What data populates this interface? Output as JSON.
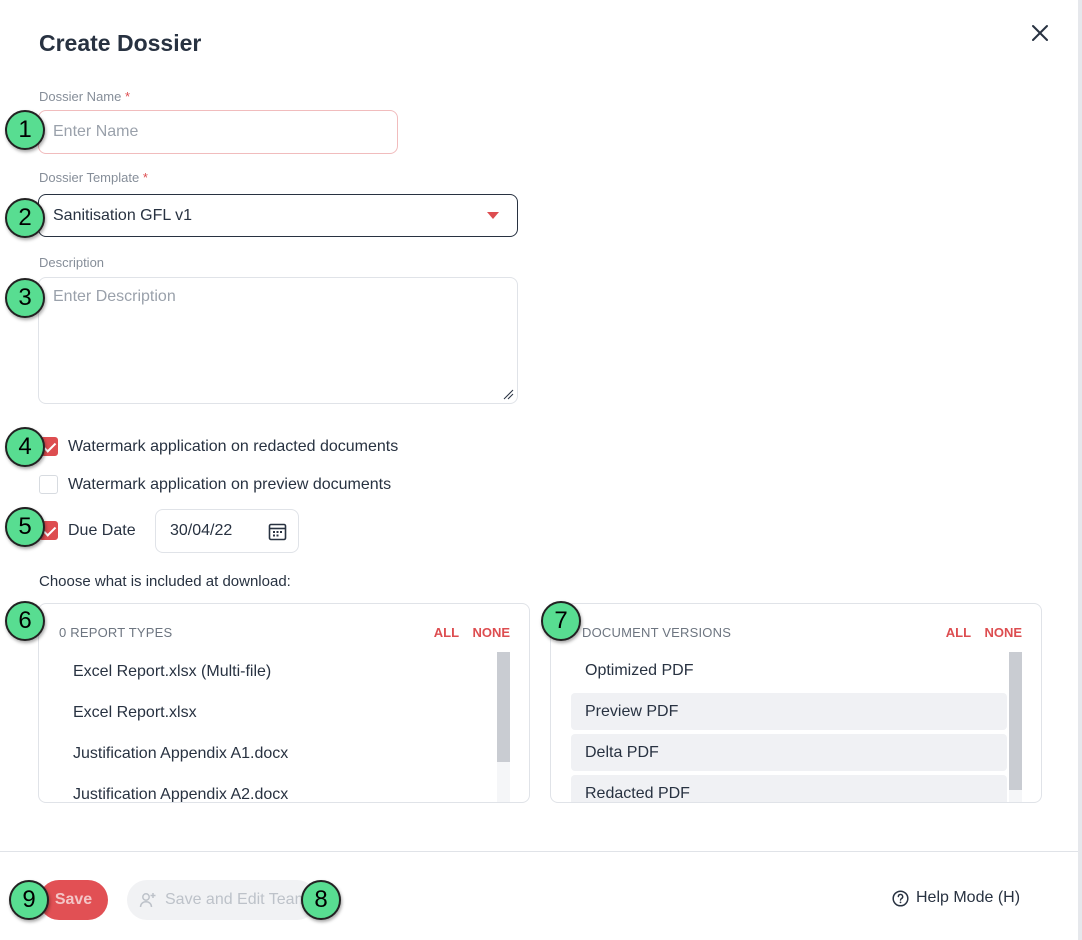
{
  "dialog": {
    "title": "Create Dossier"
  },
  "form": {
    "name_label": "Dossier Name",
    "name_required": "*",
    "name_placeholder": "Enter Name",
    "template_label": "Dossier Template",
    "template_required": "*",
    "template_value": "Sanitisation GFL v1",
    "description_label": "Description",
    "description_placeholder": "Enter Description",
    "watermark_redacted_label": "Watermark application on redacted documents",
    "watermark_redacted_checked": true,
    "watermark_preview_label": "Watermark application on preview documents",
    "watermark_preview_checked": false,
    "due_date_label": "Due Date",
    "due_date_checked": true,
    "due_date_value": "30/04/22",
    "download_section_label": "Choose what is included at download:"
  },
  "report_types": {
    "header": "0 REPORT TYPES",
    "all": "ALL",
    "none": "NONE",
    "items": [
      {
        "label": "Excel Report.xlsx (Multi-file)",
        "selected": false
      },
      {
        "label": "Excel Report.xlsx",
        "selected": false
      },
      {
        "label": "Justification Appendix A1.docx",
        "selected": false
      },
      {
        "label": "Justification Appendix A2.docx",
        "selected": false
      }
    ]
  },
  "document_versions": {
    "header": "DOCUMENT VERSIONS",
    "all": "ALL",
    "none": "NONE",
    "items": [
      {
        "label": "Optimized PDF",
        "selected": false
      },
      {
        "label": "Preview PDF",
        "selected": true
      },
      {
        "label": "Delta PDF",
        "selected": true
      },
      {
        "label": "Redacted PDF",
        "selected": true
      }
    ]
  },
  "footer": {
    "save_label": "Save",
    "save_edit_team_label": "Save and Edit Team",
    "help_mode_label": "Help Mode (H)"
  },
  "annotations": {
    "badges": [
      "1",
      "2",
      "3",
      "4",
      "5",
      "6",
      "7",
      "8",
      "9"
    ]
  },
  "colors": {
    "accent": "#dd4d50",
    "badge": "#58dd91",
    "text": "#283241"
  }
}
